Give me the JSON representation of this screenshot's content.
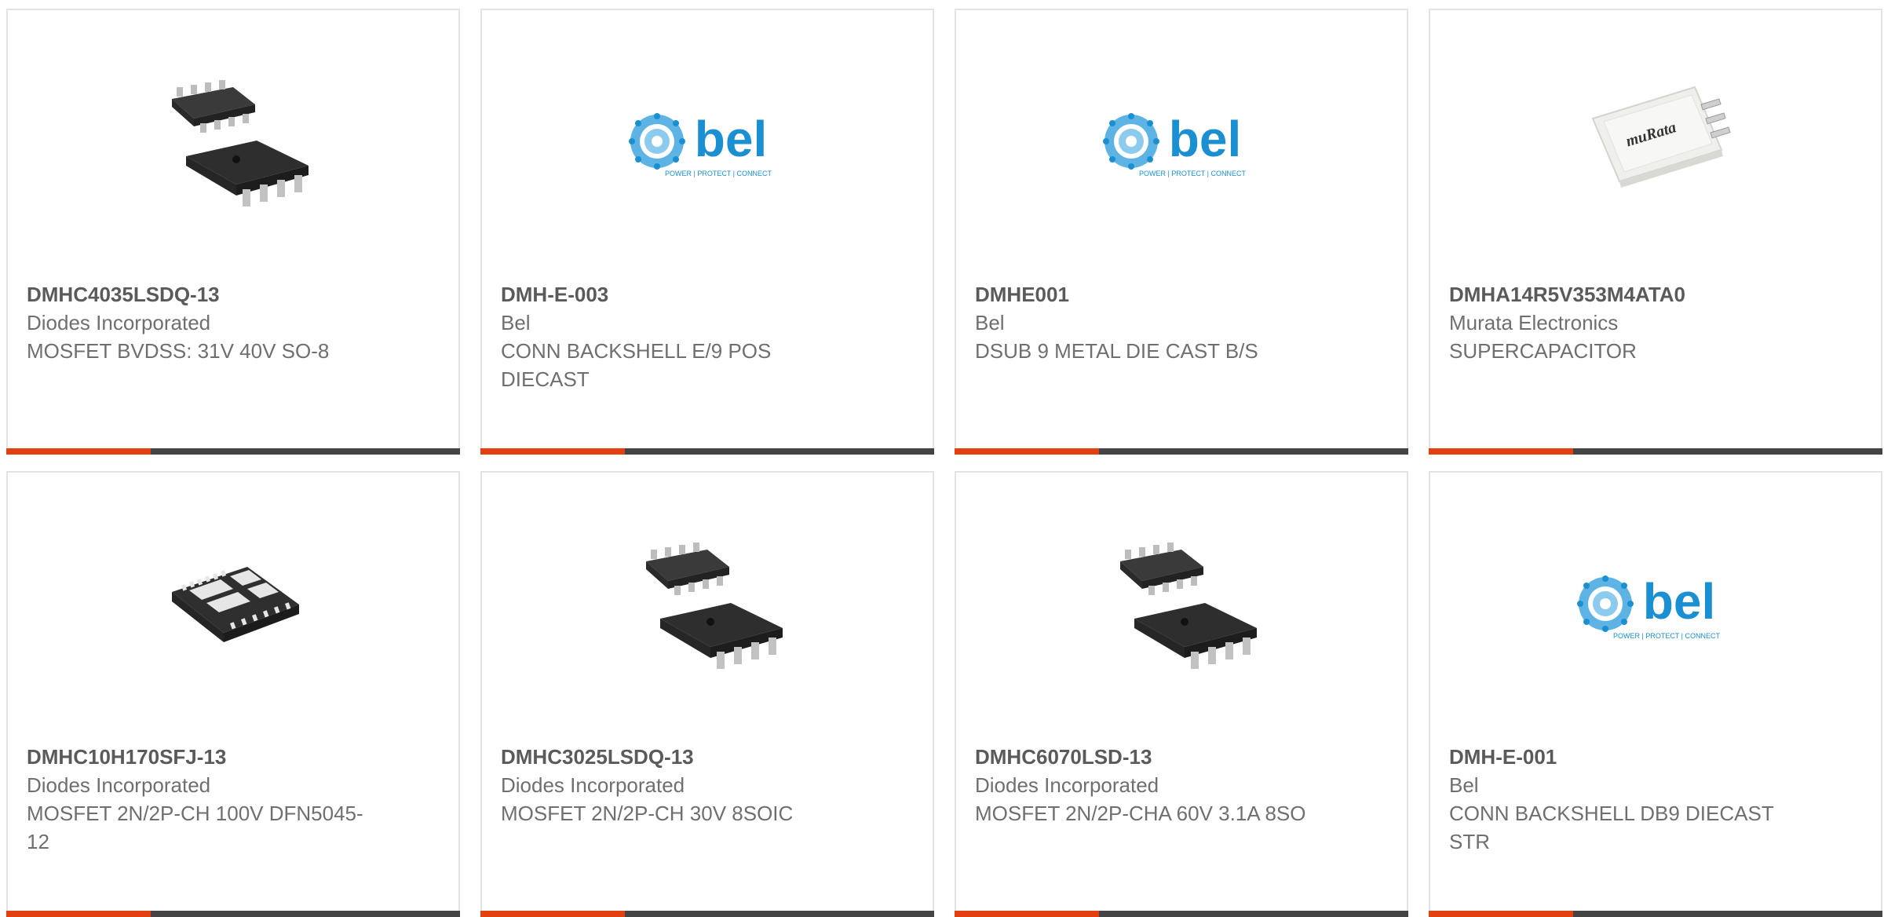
{
  "products": [
    {
      "part_number": "DMHC4035LSDQ-13",
      "manufacturer": "Diodes Incorporated",
      "description": "MOSFET BVDSS: 31V 40V SO-8",
      "image": "soic-8-package-icon"
    },
    {
      "part_number": "DMH-E-003",
      "manufacturer": "Bel",
      "description": "CONN BACKSHELL E/9 POS DIECAST",
      "image": "bel-logo-icon"
    },
    {
      "part_number": "DMHE001",
      "manufacturer": "Bel",
      "description": "DSUB 9 METAL DIE CAST B/S",
      "image": "bel-logo-icon"
    },
    {
      "part_number": "DMHA14R5V353M4ATA0",
      "manufacturer": "Murata Electronics",
      "description": "SUPERCAPACITOR",
      "image": "murata-supercapacitor-icon"
    },
    {
      "part_number": "DMHC10H170SFJ-13",
      "manufacturer": "Diodes Incorporated",
      "description": "MOSFET 2N/2P-CH 100V DFN5045-12",
      "image": "dfn-package-icon"
    },
    {
      "part_number": "DMHC3025LSDQ-13",
      "manufacturer": "Diodes Incorporated",
      "description": "MOSFET 2N/2P-CH 30V 8SOIC",
      "image": "soic-8-package-icon"
    },
    {
      "part_number": "DMHC6070LSD-13",
      "manufacturer": "Diodes Incorporated",
      "description": "MOSFET 2N/2P-CHA 60V 3.1A 8SO",
      "image": "soic-8-package-icon"
    },
    {
      "part_number": "DMH-E-001",
      "manufacturer": "Bel",
      "description": "CONN BACKSHELL DB9 DIECAST STR",
      "image": "bel-logo-icon"
    }
  ],
  "logos": {
    "bel_name": "bel",
    "bel_tagline": "POWER | PROTECT | CONNECT",
    "murata_name": "muRata"
  },
  "colors": {
    "accent": "#e34011",
    "bar": "#444444",
    "bel_blue": "#1a8fd1"
  }
}
